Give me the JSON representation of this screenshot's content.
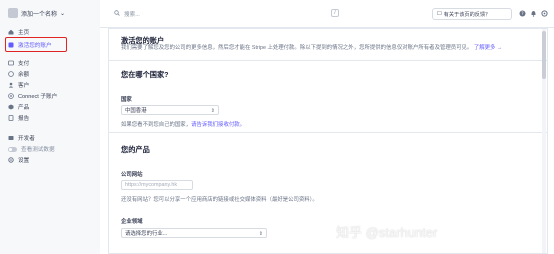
{
  "sidebar": {
    "account_name": "添加一个名称",
    "items": [
      {
        "label": "主页",
        "icon": "home-icon"
      },
      {
        "label": "激活您的账户",
        "icon": "activate-icon",
        "active": true
      },
      {
        "label": "支付",
        "icon": "payments-icon"
      },
      {
        "label": "余额",
        "icon": "balance-icon"
      },
      {
        "label": "客户",
        "icon": "customers-icon"
      },
      {
        "label": "Connect 子账户",
        "icon": "connect-icon"
      },
      {
        "label": "产品",
        "icon": "products-icon"
      },
      {
        "label": "报告",
        "icon": "reports-icon"
      },
      {
        "label": "开发者",
        "icon": "developers-icon"
      },
      {
        "label": "查看测试数据",
        "icon": "toggle-icon"
      },
      {
        "label": "设置",
        "icon": "settings-icon"
      }
    ]
  },
  "topbar": {
    "search_placeholder": "搜索...",
    "search_shortcut": "/",
    "feedback_label": "有关于该页的反馈？"
  },
  "main": {
    "activate": {
      "title": "激活您的账户",
      "description": "我们需要了解您及您的公司的更多信息，然后您才能在 Stripe 上处理付款。除以下提到的情况之外，您所提供的信息仅对账户所有者及管理员可见。",
      "learn_more": "了解更多 →"
    },
    "country": {
      "title": "您在哪个国家?",
      "label": "国家",
      "selected": "中国香港",
      "hint": "如果您看不到您自己的国家，",
      "hint_link": "请告诉我们接收付款。"
    },
    "product": {
      "title": "您的产品",
      "website_label": "公司网站",
      "website_placeholder": "https://mycompany.hk",
      "website_hint": "还没有网站？您可以分享一个应用商店的链接或社交媒体资料（最好是公司资料）。",
      "industry_label": "企业领域",
      "industry_placeholder": "请选择您的行业..."
    }
  },
  "watermark": "知乎 @starhunter"
}
